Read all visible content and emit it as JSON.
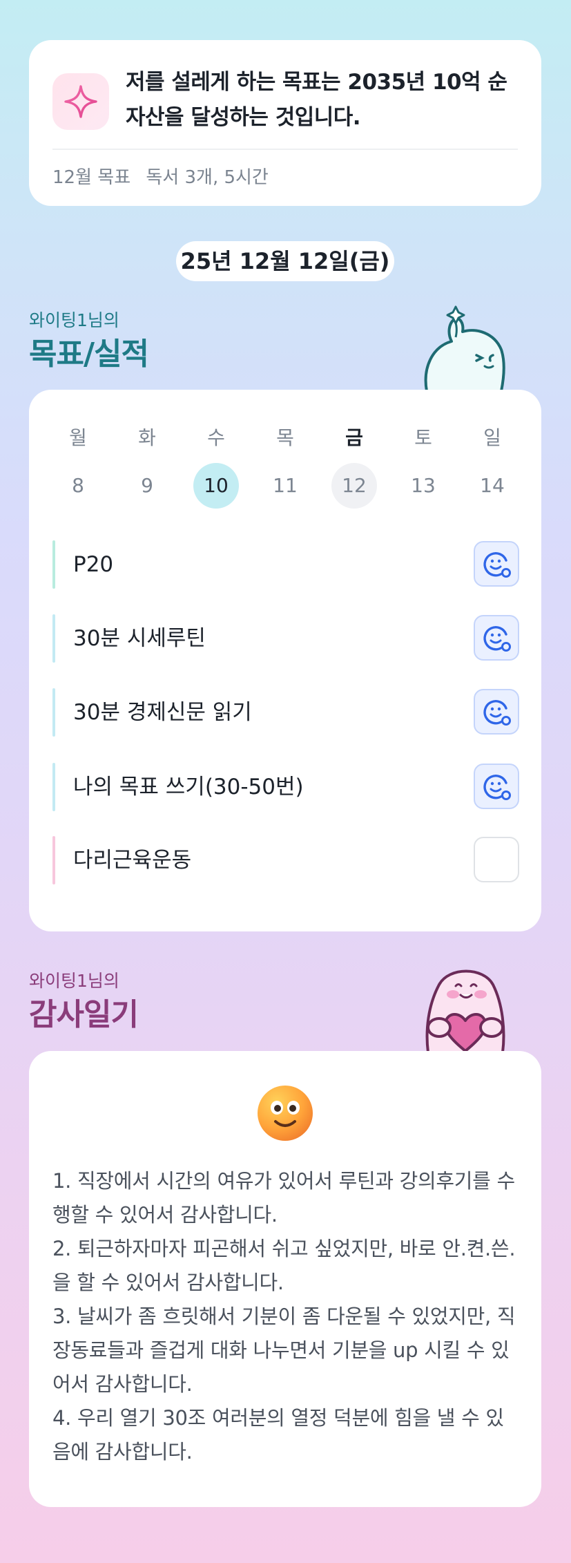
{
  "goal_card": {
    "statement": "저를 설레게 하는 목표는 2035년 10억 순자산을 달성하는 것입니다.",
    "month_goal_label": "12월 목표",
    "month_goal_value": "독서 3개, 5시간"
  },
  "date_label": "25년 12월 12일(금)",
  "goals_section": {
    "subtitle": "와이팅1님의",
    "title": "목표/실적",
    "weekdays": [
      "월",
      "화",
      "수",
      "목",
      "금",
      "토",
      "일"
    ],
    "days": [
      "8",
      "9",
      "10",
      "11",
      "12",
      "13",
      "14"
    ],
    "selected_day": "10",
    "today": "12",
    "tasks": [
      {
        "label": "P20",
        "done": true,
        "bar_color": "#b9ecdf"
      },
      {
        "label": "30분 시세루틴",
        "done": true,
        "bar_color": "#c3eaf3"
      },
      {
        "label": "30분 경제신문 읽기",
        "done": true,
        "bar_color": "#c3eaf3"
      },
      {
        "label": "나의 목표 쓰기(30-50번)",
        "done": true,
        "bar_color": "#c3eaf3"
      },
      {
        "label": "다리근육운동",
        "done": false,
        "bar_color": "#f7c7dd"
      }
    ]
  },
  "diary_section": {
    "subtitle": "와이팅1님의",
    "title": "감사일기",
    "entries": [
      "1. 직장에서 시간의 여유가 있어서 루틴과 강의후기를 수행할 수 있어서 감사합니다.",
      "2. 퇴근하자마자 피곤해서 쉬고 싶었지만, 바로 안.켠.쓴.을 할 수 있어서 감사합니다.",
      "3. 날씨가 좀 흐릿해서 기분이 좀 다운될 수 있었지만, 직장동료들과 즐겁게 대화 나누면서 기분을 up 시킬 수 있어서 감사합니다.",
      "4. 우리 열기 30조 여러분의 열정 덕분에 힘을 낼 수 있음에 감사합니다."
    ]
  },
  "colors": {
    "teal_title": "#1e7a86",
    "purple_title": "#8a3c7a",
    "selected_day": "#c3edf3",
    "check_blue": "#2f66e8"
  },
  "icons": {
    "goal": "sparkle-icon",
    "check": "smile-face-check-icon",
    "diary": "smiling-face-emoji"
  }
}
